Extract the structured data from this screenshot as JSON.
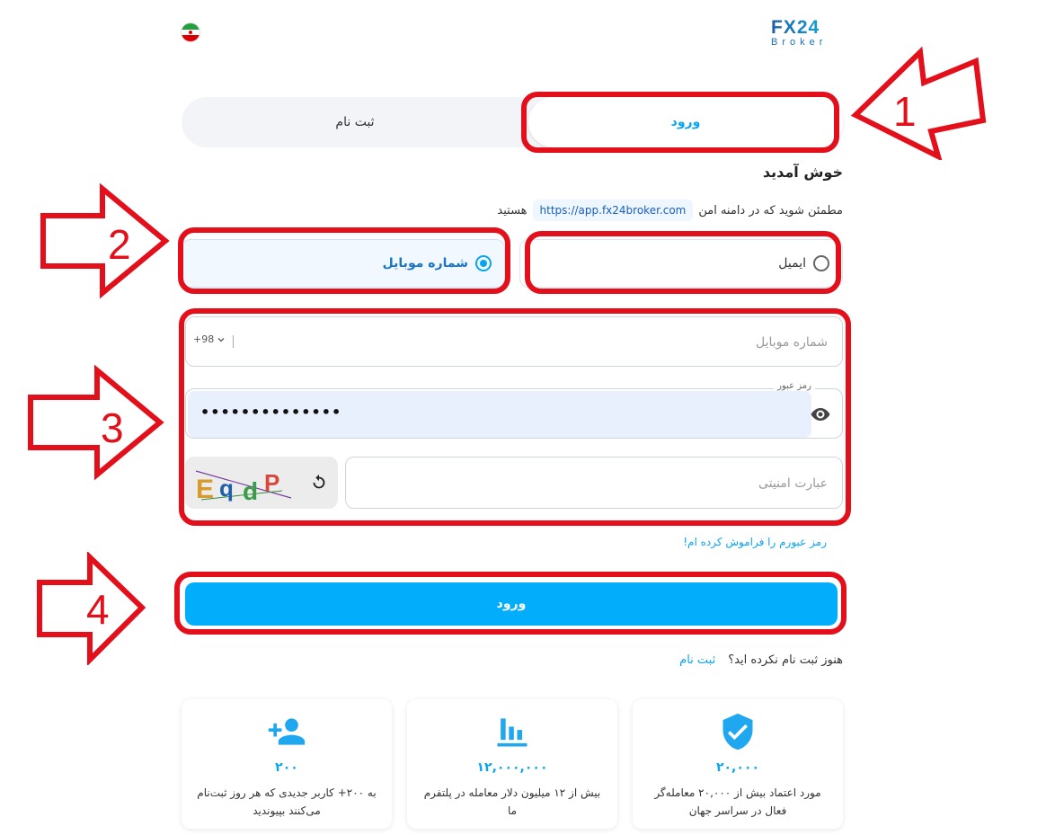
{
  "header": {
    "logo_main": "FX24",
    "logo_sub": "Broker",
    "colors": {
      "brand": "#0aa5f0",
      "accent_red": "#e3101b"
    }
  },
  "tabs": {
    "login": "ورود",
    "signup": "ثبت نام"
  },
  "welcome": "خوش آمدید",
  "secure_notice": {
    "before": "مطمئن شوید که در دامنه امن",
    "domain": "https://app.fx24broker.com",
    "after": "هستید"
  },
  "login_method": {
    "email": "ایمیل",
    "mobile": "شماره موبایل",
    "selected": "mobile"
  },
  "form": {
    "phone_placeholder": "شماره موبایل",
    "country_code": "+98",
    "password_label": "رمز عبور",
    "password_value": "••••••••••••••",
    "captcha_text": "EqdP",
    "captcha_placeholder": "عبارت امنیتی",
    "forgot": "رمز عبورم را فراموش کرده ام!",
    "submit": "ورود"
  },
  "no_account": {
    "question": "هنوز ثبت نام نکرده اید؟",
    "link": "ثبت نام"
  },
  "stats": [
    {
      "icon": "shield-check-icon",
      "number": "۲۰,۰۰۰",
      "desc": "مورد اعتماد بیش از ۲۰,۰۰۰ معامله‌گر فعال در سراسر جهان"
    },
    {
      "icon": "bar-chart-icon",
      "number": "۱۲,۰۰۰,۰۰۰",
      "desc": "بیش از ۱۲ میلیون دلار معامله در پلتفرم ما"
    },
    {
      "icon": "add-user-icon",
      "number": "۲۰۰",
      "desc": "به ۲۰۰+ کاربر جدیدی که هر روز ثبت‌نام می‌کنند بپیوندید"
    }
  ],
  "annotations": [
    "1",
    "2",
    "3",
    "4"
  ]
}
